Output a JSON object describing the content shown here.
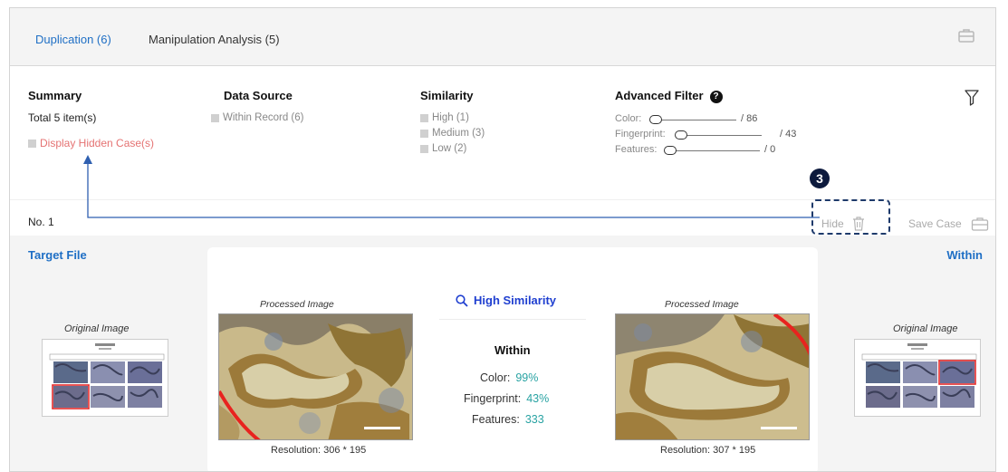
{
  "tabs": [
    {
      "label": "Duplication (6)",
      "active": true
    },
    {
      "label": "Manipulation Analysis (5)",
      "active": false
    }
  ],
  "summary": {
    "title": "Summary",
    "total": "Total 5 item(s)",
    "hidden_case_label": "Display Hidden Case(s)"
  },
  "data_source": {
    "title": "Data Source",
    "options": [
      "Within Record (6)"
    ]
  },
  "similarity": {
    "title": "Similarity",
    "options": [
      "High (1)",
      "Medium (3)",
      "Low (2)"
    ]
  },
  "advanced_filter": {
    "title": "Advanced Filter",
    "help_icon": "question-circle-icon",
    "sliders": [
      {
        "label": "Color:",
        "max": "/ 86",
        "value": 0
      },
      {
        "label": "Fingerprint:",
        "max": "/ 43",
        "value": 0
      },
      {
        "label": "Features:",
        "max": "/ 0",
        "value": 0
      }
    ]
  },
  "record": {
    "number": "No. 1",
    "hide_label": "Hide",
    "save_label": "Save Case",
    "callout_number": "3"
  },
  "comparison": {
    "target_title": "Target File",
    "within_title": "Within",
    "original_label": "Original Image",
    "left": {
      "processed_label": "Processed Image",
      "resolution": "Resolution: 306 * 195"
    },
    "right": {
      "processed_label": "Processed Image",
      "resolution": "Resolution: 307 * 195"
    },
    "similarity_title": "High Similarity",
    "source_heading": "Within",
    "metrics": [
      {
        "label": "Color:",
        "value": "99%"
      },
      {
        "label": "Fingerprint:",
        "value": "43%"
      },
      {
        "label": "Features:",
        "value": "333"
      }
    ]
  },
  "colors": {
    "accent": "#1f6fc5",
    "similarity": "#1f3fd0",
    "metric_value": "#29a3a3",
    "hidden_case": "#e57373",
    "callout": "#1e3a6b"
  }
}
